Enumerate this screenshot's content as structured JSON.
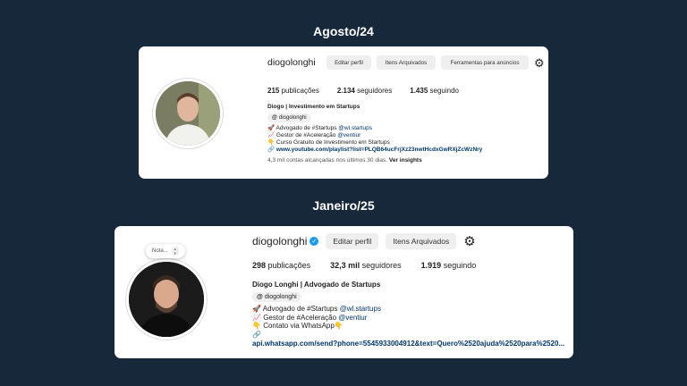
{
  "sections": [
    {
      "period": "Agosto/24",
      "username": "diogolonghi",
      "verified": false,
      "buttons": [
        "Editar perfil",
        "Itens Arquivados",
        "Ferramentas para anúncios"
      ],
      "stats": {
        "posts": "215",
        "posts_label": "publicações",
        "followers": "2.134",
        "followers_label": "seguidores",
        "following": "1.435",
        "following_label": "seguindo"
      },
      "bio_name": "Diogo | Investimento em Startups",
      "threads_handle": "diogolonghi",
      "bio_lines": [
        {
          "emoji": "🚀",
          "text": "Advogado de #Startups ",
          "mention": "@wl.startups"
        },
        {
          "emoji": "📈",
          "text": "Gestor de #Aceleração ",
          "mention": "@ventiur"
        },
        {
          "emoji": "👇",
          "text": "Curso Gratuito de Investimento em Startups",
          "mention": ""
        }
      ],
      "link": "www.youtube.com/playlist?list=PLQB64ucFrjXz23nwtHcdxGwRXjZcWzNry",
      "insights_prefix": "4,3 mil contas alcançadas nos últimos 30 dias. ",
      "insights_link": "Ver insights"
    },
    {
      "period": "Janeiro/25",
      "username": "diogolonghi",
      "verified": true,
      "note_label": "Nota...",
      "buttons": [
        "Editar perfil",
        "Itens Arquivados"
      ],
      "stats": {
        "posts": "298",
        "posts_label": "publicações",
        "followers": "32,3 mil",
        "followers_label": "seguidores",
        "following": "1.919",
        "following_label": "seguindo"
      },
      "bio_name": "Diogo Longhi | Advogado de Startups",
      "threads_handle": "diogolonghi",
      "bio_lines": [
        {
          "emoji": "🚀",
          "text": "Advogado de #Startups ",
          "mention": "@wl.startups"
        },
        {
          "emoji": "📈",
          "text": "Gestor de #Aceleração ",
          "mention": "@ventiur"
        },
        {
          "emoji": "👇",
          "text": "Contato via WhatsApp👇",
          "mention": ""
        }
      ],
      "link": "api.whatsapp.com/send?phone=5545933004912&text=Quero%2520ajuda%2520para%2520..."
    }
  ],
  "icons": {
    "gear": "gear-icon",
    "verified": "verified-badge-icon",
    "threads": "threads-icon",
    "link": "link-icon"
  },
  "colors": {
    "background": "#17283a",
    "card": "#ffffff",
    "button": "#efefef",
    "mention": "#00376b",
    "verified": "#1d9bf0"
  }
}
